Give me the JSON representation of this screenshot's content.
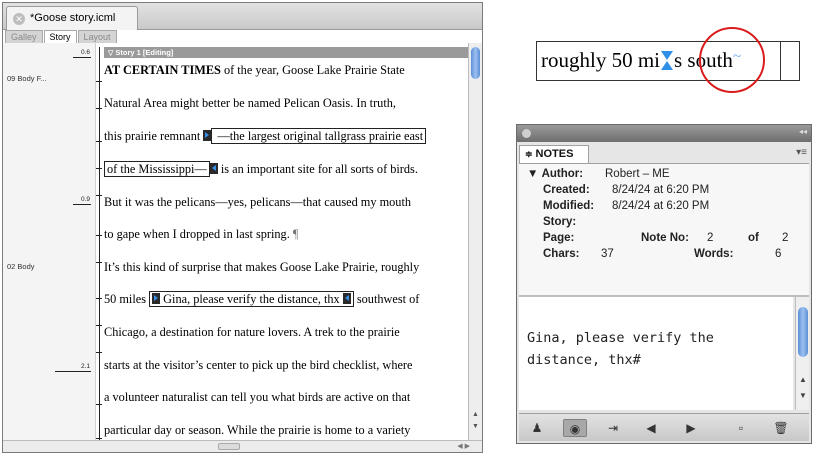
{
  "story_window": {
    "doc_tab": "*Goose story.icml",
    "view_tabs": [
      "Galley",
      "Story",
      "Layout"
    ],
    "story_header": "Story 1 [Editing]",
    "paragraph_styles": [
      "09 Body F...",
      "02 Body"
    ],
    "depth_marks": [
      "0.6",
      "0.9",
      "2.1"
    ],
    "lines": [
      {
        "bold": "AT CERTAIN TIMES",
        "text": " of the year, Goose Lake Prairie State"
      },
      {
        "text": "Natural Area might better be named Pelican Oasis. In truth,"
      },
      {
        "before": "this prairie remnant ",
        "after": " —the largest original tallgrass prairie east"
      },
      {
        "before": "of the Mississippi—",
        "after": " is an important site for all sorts of birds."
      },
      {
        "text": "But it was the pelicans—yes, pelicans—that caused my mouth"
      },
      {
        "text": "to gape when I dropped in last spring.",
        "pilcrow": "¶"
      },
      {
        "text": "It’s this kind of surprise that makes Goose Lake Prairie, roughly"
      },
      {
        "before": "50 miles ",
        "note": "Gina, please verify the distance, thx",
        "after": " southwest of"
      },
      {
        "text": "Chicago, a destination for nature lovers. A trek to the prairie"
      },
      {
        "text": "starts at the visitor’s center to pick up the bird checklist, where"
      },
      {
        "text": "a volunteer naturalist can tell you what birds are active on that"
      },
      {
        "text": "particular day or season. While the prairie is home to a variety"
      }
    ]
  },
  "snippet": {
    "before": "roughly 50 mi",
    "after": "s south"
  },
  "notes_panel": {
    "tab_label": "NOTES",
    "author_label": "Author:",
    "author_value": "Robert – ME",
    "created_label": "Created:",
    "created_value": "8/24/24 at 6:20 PM",
    "modified_label": "Modified:",
    "modified_value": "8/24/24 at 6:20 PM",
    "story_label": "Story:",
    "page_label": "Page:",
    "note_no_label": "Note No:",
    "note_no_value": "2",
    "of_label": "of",
    "of_value": "2",
    "chars_label": "Chars:",
    "chars_value": "37",
    "words_label": "Words:",
    "words_value": "6",
    "note_text_line1": "Gina, please verify the",
    "note_text_line2": "distance, thx#"
  },
  "accent_color": "#3a8ee6",
  "highlight_circle_color": "#d91c1c"
}
